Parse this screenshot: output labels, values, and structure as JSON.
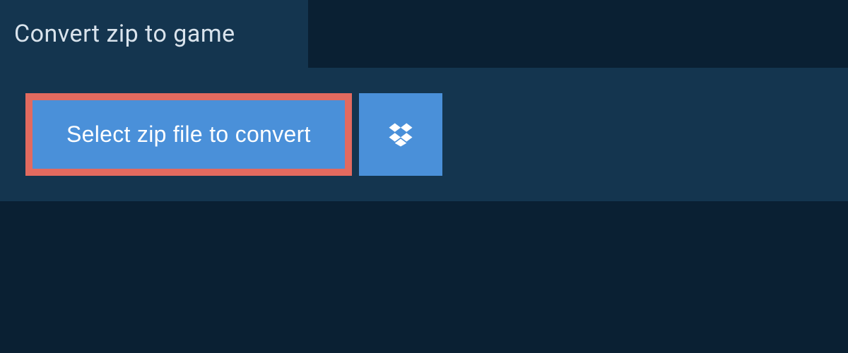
{
  "header": {
    "title": "Convert zip to game"
  },
  "actions": {
    "select_file_label": "Select zip file to convert"
  },
  "colors": {
    "background": "#0a2033",
    "panel": "#14354f",
    "button": "#4a90d9",
    "highlight_border": "#e26a5f",
    "text_light": "#d9e3ec",
    "text_white": "#ffffff"
  }
}
